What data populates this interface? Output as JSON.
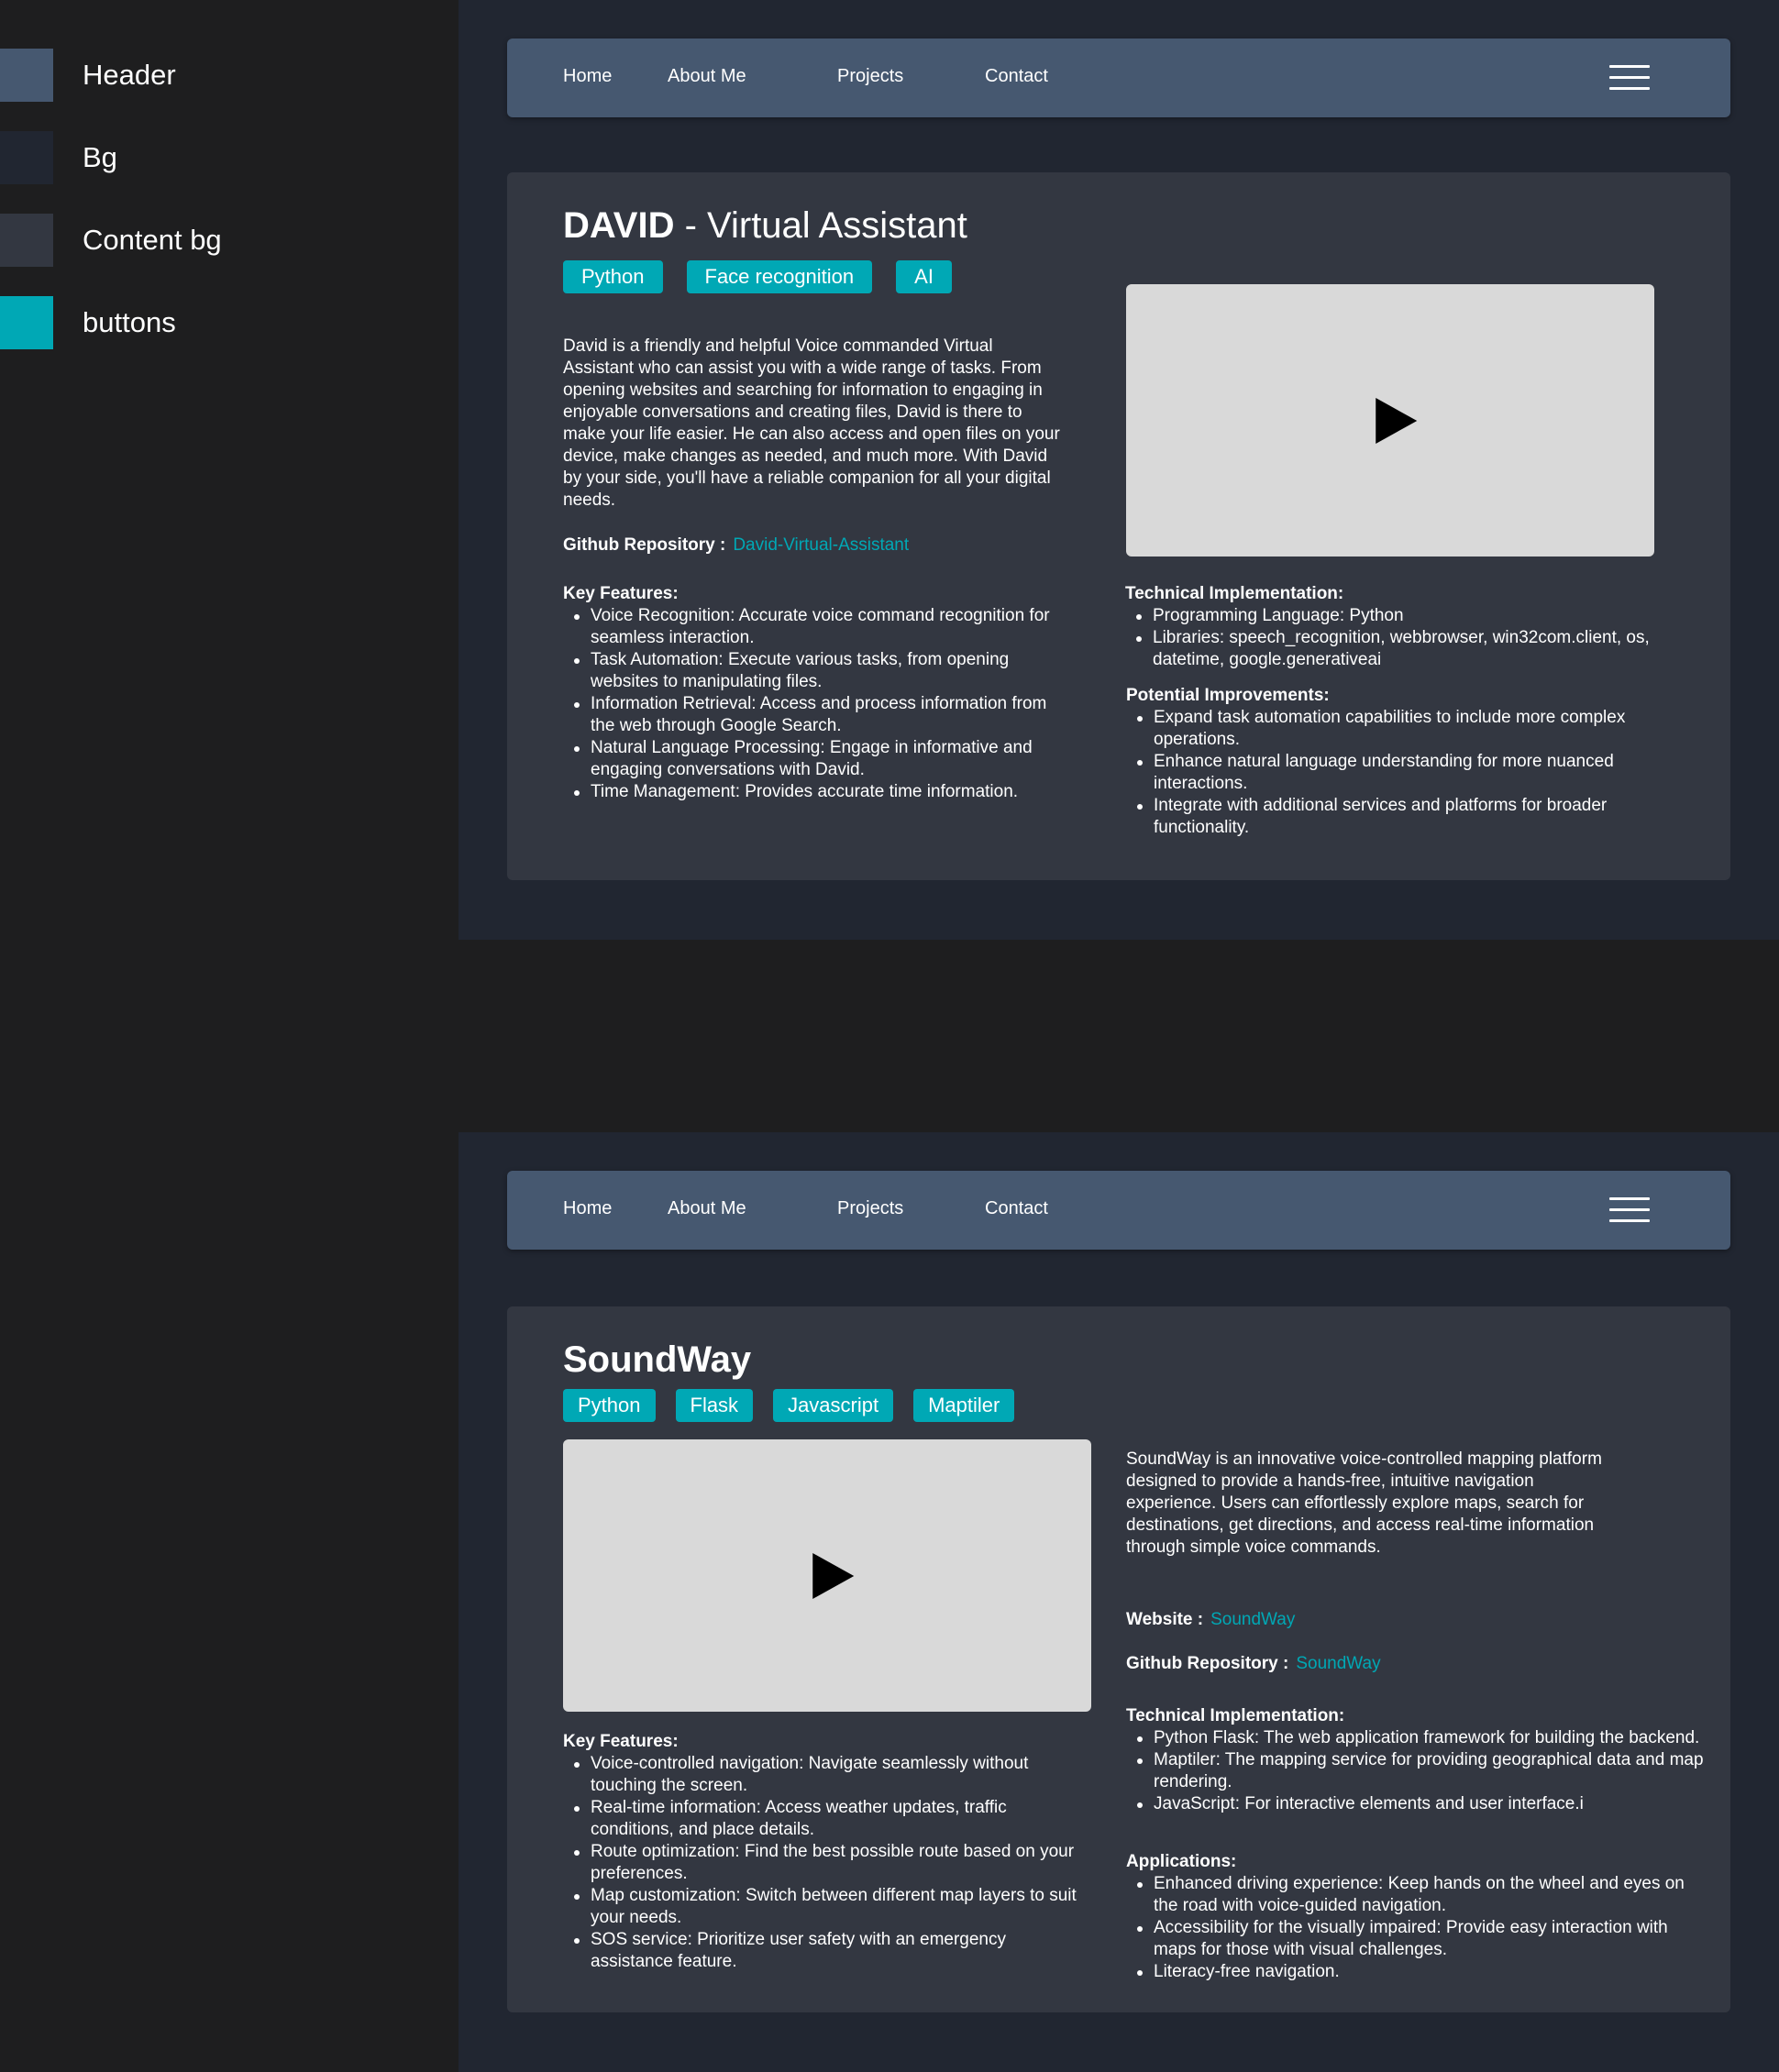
{
  "palette": [
    {
      "label": "Header",
      "color": "#465870"
    },
    {
      "label": "Bg",
      "color": "#212631"
    },
    {
      "label": "Content bg",
      "color": "#333741"
    },
    {
      "label": "buttons",
      "color": "#00a8b5"
    }
  ],
  "nav": [
    "Home",
    "About Me",
    "Projects",
    "Contact"
  ],
  "project1": {
    "title_bold": "DAVID",
    "title_rest": " - Virtual Assistant",
    "tags": [
      "Python",
      "Face recognition",
      "AI"
    ],
    "description": "David is a friendly and helpful Voice commanded Virtual Assistant who can assist you with a wide range of tasks. From opening websites and searching for information to engaging in enjoyable conversations and creating files, David is there to make your life easier. He can also access and open files on your device, make changes as needed, and much more. With David by your side, you'll have a reliable companion for all your digital needs.",
    "github_label": "Github Repository :",
    "github_link": "David-Virtual-Assistant",
    "key_features_title": "Key Features:",
    "key_features": [
      "Voice Recognition: Accurate voice command recognition for seamless interaction.",
      "Task Automation: Execute various tasks, from opening websites to manipulating files.",
      "Information Retrieval: Access and process information from the web through Google Search.",
      "Natural Language Processing: Engage in informative and engaging conversations with David.",
      "Time Management: Provides accurate time information."
    ],
    "tech_title": "Technical Implementation:",
    "tech": [
      "Programming Language: Python",
      "Libraries: speech_recognition, webbrowser, win32com.client, os, datetime, google.generativeai"
    ],
    "improvements_title": "Potential Improvements:",
    "improvements": [
      "Expand task automation capabilities to include more complex operations.",
      "Enhance natural language understanding for more nuanced interactions.",
      "Integrate with additional services and platforms for broader functionality."
    ]
  },
  "project2": {
    "title": "SoundWay",
    "tags": [
      "Python",
      "Flask",
      "Javascript",
      "Maptiler"
    ],
    "description": "SoundWay is an innovative voice-controlled mapping platform designed to provide a hands-free, intuitive navigation experience. Users can effortlessly explore maps, search for destinations, get directions, and access real-time information through simple voice commands.",
    "website_label": "Website  :",
    "website_link": "SoundWay",
    "github_label": "Github Repository :",
    "github_link": "SoundWay",
    "key_features_title": "Key Features:",
    "key_features": [
      "Voice-controlled navigation: Navigate seamlessly without touching the screen.",
      "Real-time information: Access weather updates, traffic conditions, and place details.",
      "Route optimization: Find the best possible route based on your preferences.",
      "Map customization: Switch between different map layers to suit your needs.",
      "SOS service: Prioritize user safety with an emergency assistance feature."
    ],
    "tech_title": "Technical Implementation:",
    "tech": [
      "Python Flask: The web application framework for building the backend.",
      "Maptiler: The mapping service for providing geographical data and map rendering.",
      "JavaScript: For interactive elements and user interface.i"
    ],
    "applications_title": "Applications:",
    "applications": [
      "Enhanced driving experience: Keep hands on the wheel and eyes on the road with voice-guided navigation.",
      "Accessibility for the visually impaired: Provide easy interaction with maps for those with visual challenges.",
      "Literacy-free navigation."
    ]
  }
}
